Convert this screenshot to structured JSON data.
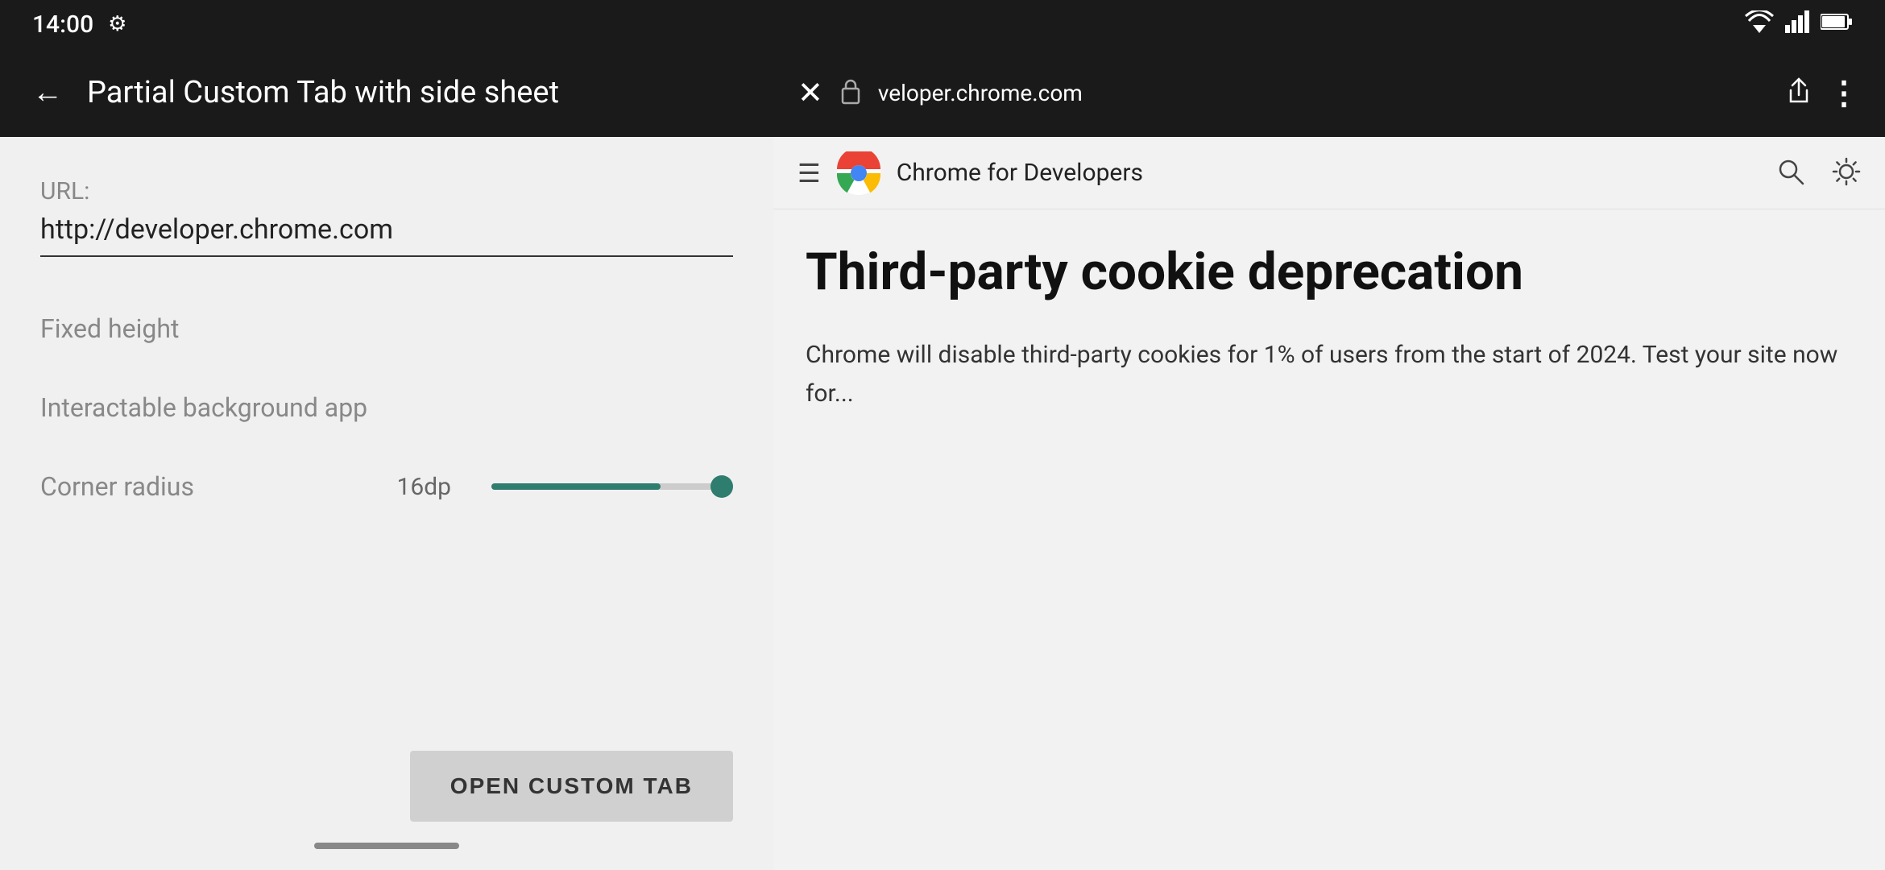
{
  "statusBar": {
    "time": "14:00",
    "icons": {
      "gear": "⚙",
      "wifi": "▲",
      "signal": "▲",
      "battery": "▮"
    }
  },
  "appToolbar": {
    "backArrow": "←",
    "title": "Partial Custom Tab with side sheet"
  },
  "form": {
    "urlLabel": "URL:",
    "urlValue": "http://developer.chrome.com",
    "fixedHeightLabel": "Fixed height",
    "interactableLabel": "Interactable background app",
    "cornerRadiusLabel": "Corner radius",
    "cornerRadiusValue": "16dp"
  },
  "button": {
    "label": "OPEN CUSTOM TAB"
  },
  "homeIndicator": "",
  "chromeTab": {
    "closeIcon": "✕",
    "lockIcon": "🔒",
    "url": "veloper.chrome.com",
    "shareIcon": "⬆",
    "moreIcon": "⋮",
    "hamburgerIcon": "☰",
    "siteName": "Chrome for Developers",
    "searchIcon": "🔍",
    "sunIcon": "✦",
    "articleTitle": "Third-party cookie deprecation",
    "articleBody": "Chrome will disable third-party cookies for 1% of users from the start of 2024. Test your site now for..."
  }
}
